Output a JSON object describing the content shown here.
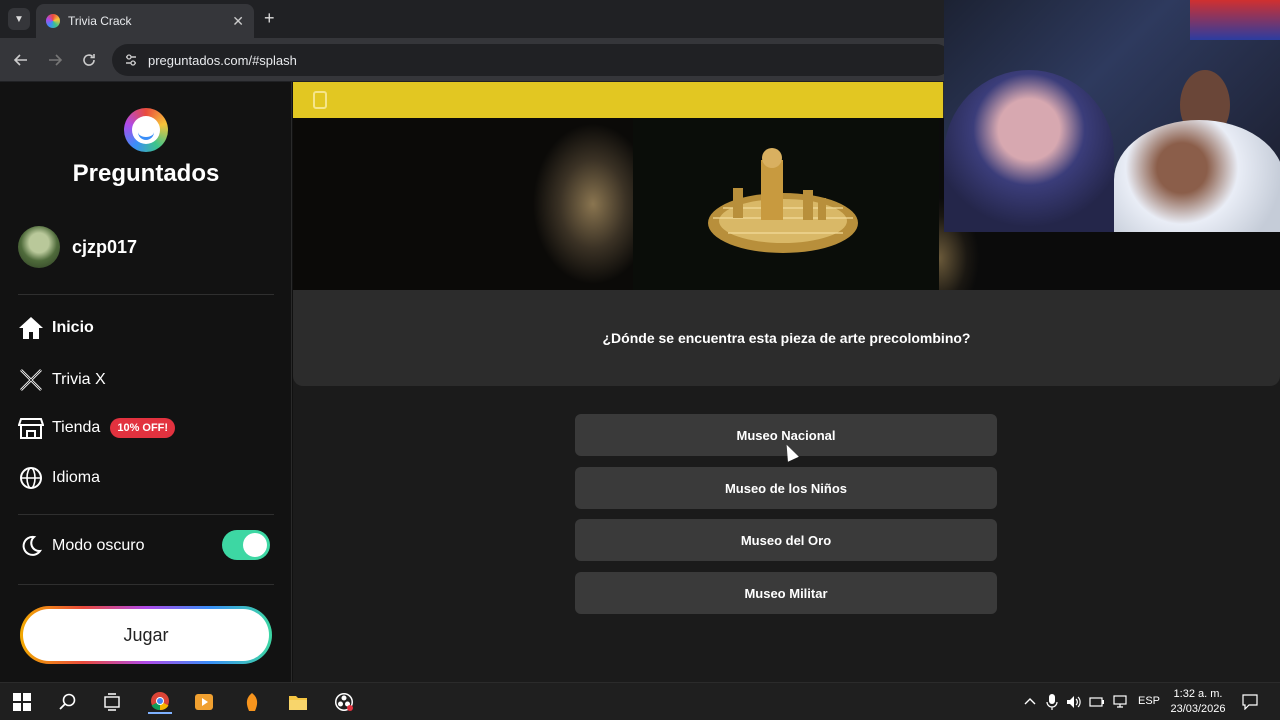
{
  "browser": {
    "tab_title": "Trivia Crack",
    "url": "preguntados.com/#splash"
  },
  "sidebar": {
    "logo_text": "Preguntados",
    "username": "cjzp017",
    "menu": [
      {
        "label": "Inicio",
        "icon": "home-icon"
      },
      {
        "label": "Trivia X",
        "icon": "x-logo-icon"
      },
      {
        "label": "Tienda",
        "icon": "store-icon",
        "badge": "10% OFF!"
      },
      {
        "label": "Idioma",
        "icon": "globe-icon"
      }
    ],
    "dark_mode_label": "Modo oscuro",
    "dark_mode_on": true,
    "play_label": "Jugar"
  },
  "question": {
    "text": "¿Dónde se encuentra esta pieza de arte precolombino?",
    "answers": [
      "Museo Nacional",
      "Museo de los Niños",
      "Museo del Oro",
      "Museo Militar"
    ]
  },
  "taskbar": {
    "language": "ESP",
    "time": "1:32 a. m.",
    "date": "23/03/2026"
  },
  "colors": {
    "accent_green": "#3dd7a3",
    "yellow_bar": "#e2c722",
    "badge_red": "#e2323f"
  }
}
